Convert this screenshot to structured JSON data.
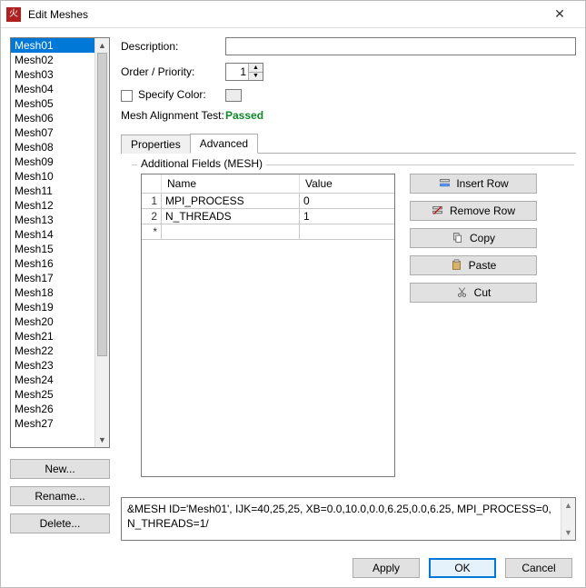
{
  "window": {
    "title": "Edit Meshes",
    "icon": "flame-icon",
    "close_label": "✕"
  },
  "sidebar": {
    "items": [
      "Mesh01",
      "Mesh02",
      "Mesh03",
      "Mesh04",
      "Mesh05",
      "Mesh06",
      "Mesh07",
      "Mesh08",
      "Mesh09",
      "Mesh10",
      "Mesh11",
      "Mesh12",
      "Mesh13",
      "Mesh14",
      "Mesh15",
      "Mesh16",
      "Mesh17",
      "Mesh18",
      "Mesh19",
      "Mesh20",
      "Mesh21",
      "Mesh22",
      "Mesh23",
      "Mesh24",
      "Mesh25",
      "Mesh26",
      "Mesh27"
    ],
    "selected_index": 0,
    "buttons": {
      "new": "New...",
      "rename": "Rename...",
      "delete": "Delete..."
    }
  },
  "form": {
    "description_label": "Description:",
    "description_value": "",
    "order_label": "Order / Priority:",
    "order_value": "1",
    "specify_color_label": "Specify Color:",
    "specify_color_checked": false,
    "mesh_alignment_label": "Mesh Alignment Test:",
    "mesh_alignment_status": "Passed"
  },
  "tabs": {
    "items": [
      {
        "id": "properties",
        "label": "Properties"
      },
      {
        "id": "advanced",
        "label": "Advanced"
      }
    ],
    "active": "advanced"
  },
  "advanced": {
    "group_title": "Additional Fields (MESH)",
    "table": {
      "headers": {
        "name": "Name",
        "value": "Value"
      },
      "rows": [
        {
          "num": "1",
          "name": "MPI_PROCESS",
          "value": "0"
        },
        {
          "num": "2",
          "name": "N_THREADS",
          "value": "1"
        },
        {
          "num": "*",
          "name": "",
          "value": ""
        }
      ]
    },
    "buttons": {
      "insert_row": "Insert Row",
      "remove_row": "Remove Row",
      "copy": "Copy",
      "paste": "Paste",
      "cut": "Cut"
    }
  },
  "record_text": "&MESH ID='Mesh01', IJK=40,25,25, XB=0.0,10.0,0.0,6.25,0.0,6.25, MPI_PROCESS=0, N_THREADS=1/",
  "footer": {
    "apply": "Apply",
    "ok": "OK",
    "cancel": "Cancel"
  }
}
